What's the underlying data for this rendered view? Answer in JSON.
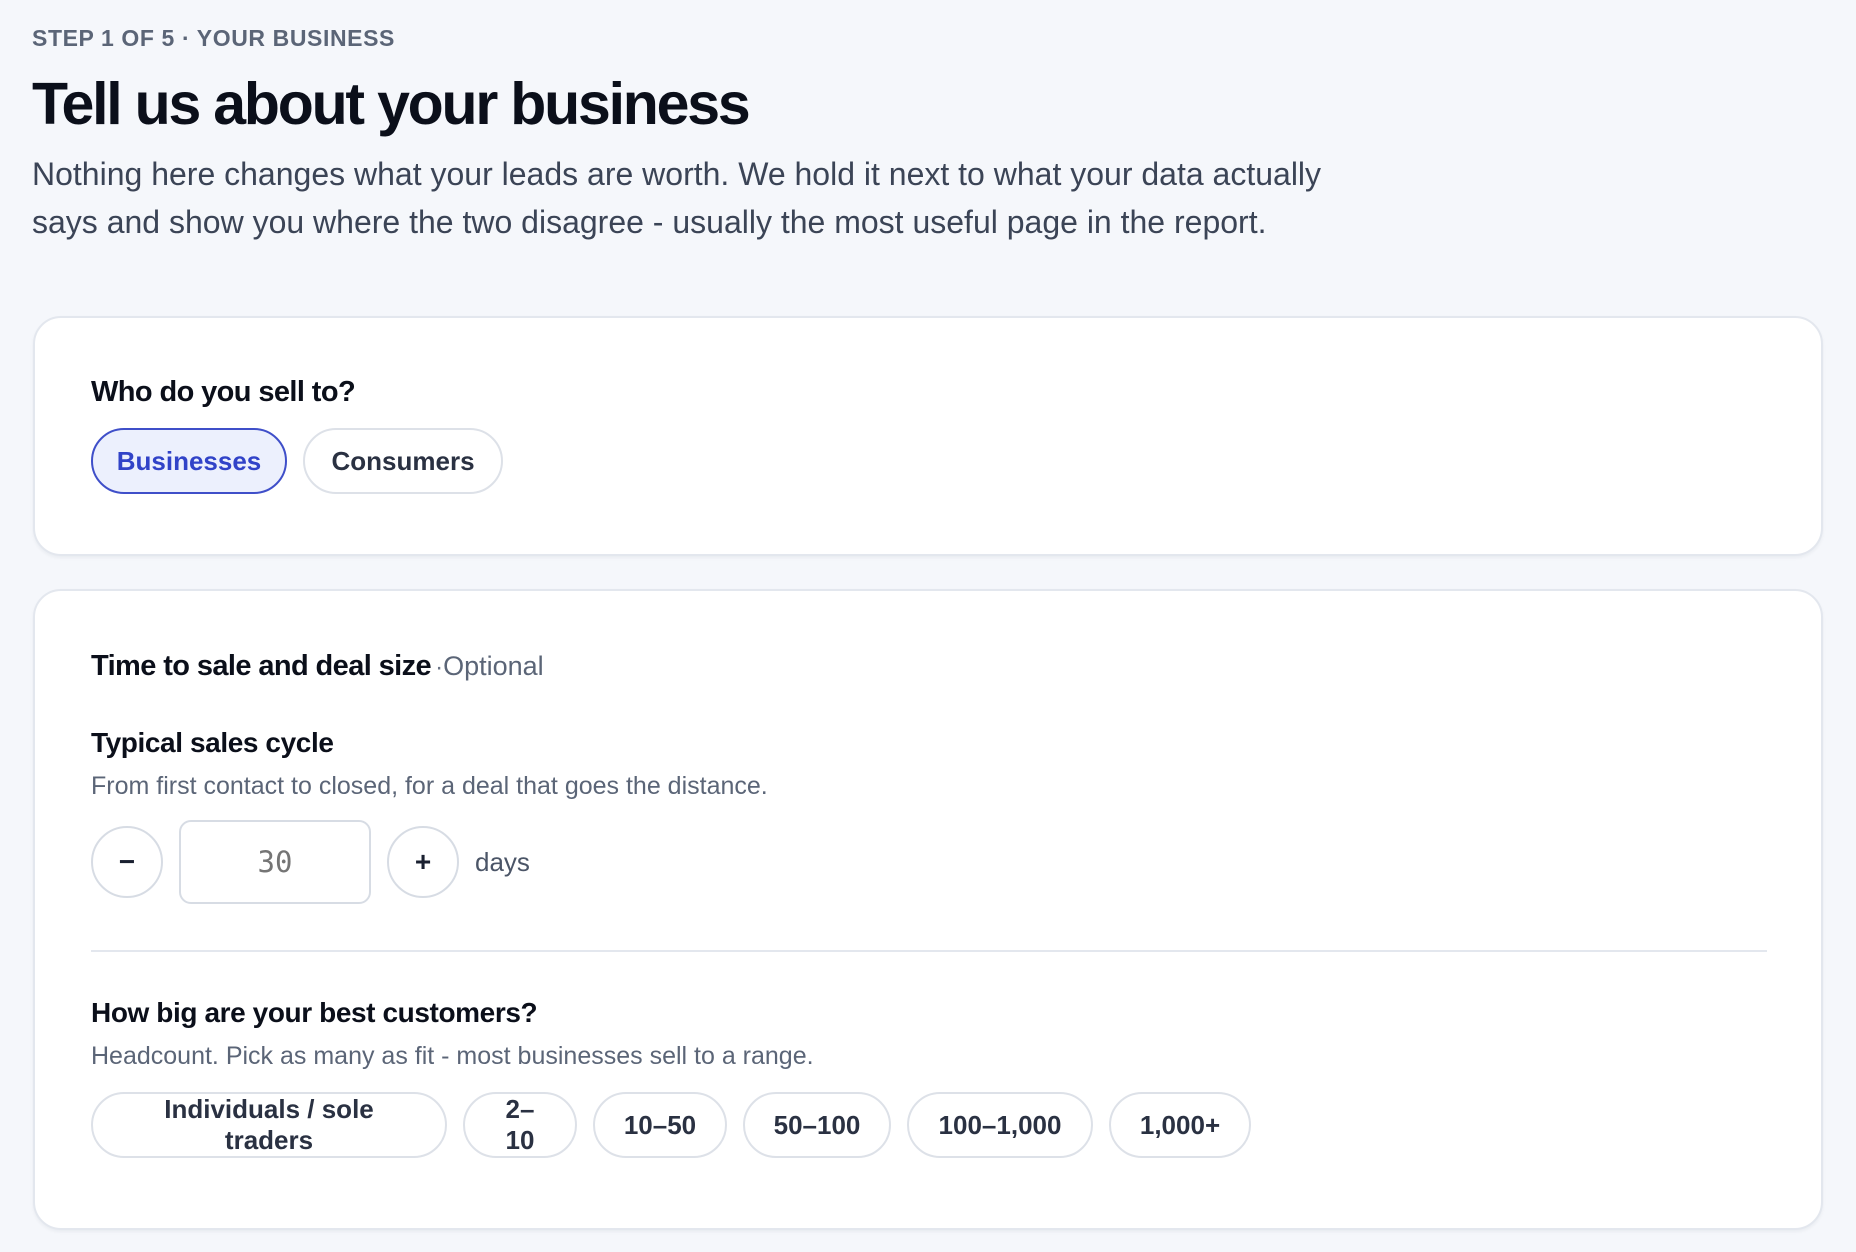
{
  "header": {
    "step_label": "STEP 1 OF 5 · YOUR BUSINESS",
    "title": "Tell us about your business",
    "intro_line1": "Nothing here changes what your leads are worth. We hold it next to what your data actually",
    "intro_line2": "says and show you where the two disagree - usually the most useful page in the report."
  },
  "audience": {
    "question": "Who do you sell to?",
    "options": [
      {
        "label": "Businesses",
        "selected": true
      },
      {
        "label": "Consumers",
        "selected": false
      }
    ]
  },
  "deal": {
    "heading": "Time to sale and deal size",
    "separator": "·",
    "optional_label": "Optional",
    "sales_cycle": {
      "label": "Typical sales cycle",
      "help": "From first contact to closed, for a deal that goes the distance.",
      "decrement_symbol": "−",
      "increment_symbol": "+",
      "placeholder": "30",
      "unit": "days"
    },
    "customer_size": {
      "label": "How big are your best customers?",
      "help": "Headcount. Pick as many as fit - most businesses sell to a range.",
      "options": [
        "Individuals / sole traders",
        "2–10",
        "10–50",
        "50–100",
        "100–1,000",
        "1,000+"
      ]
    }
  },
  "colors": {
    "background": "#f5f7fb",
    "accent": "#3143c8",
    "accent_bg": "#ecf0fd",
    "border": "#dde1e8"
  }
}
